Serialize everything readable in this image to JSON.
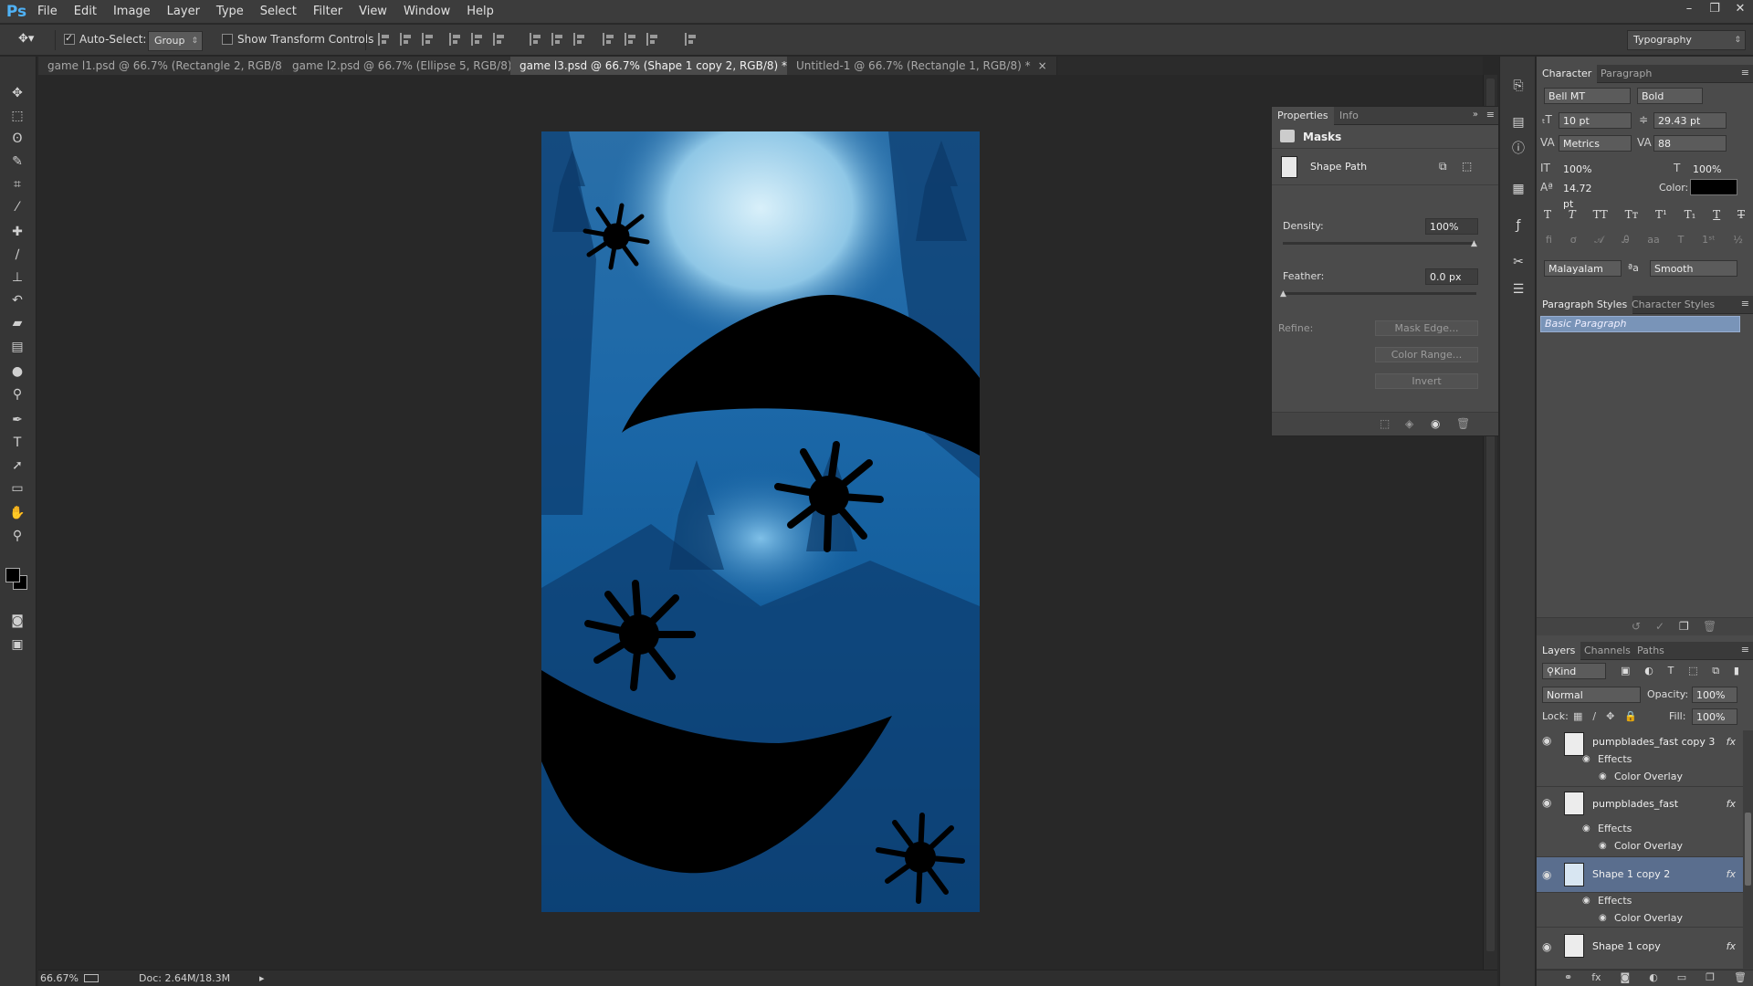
{
  "app": {
    "logo": "Ps"
  },
  "menu": [
    "File",
    "Edit",
    "Image",
    "Layer",
    "Type",
    "Select",
    "Filter",
    "View",
    "Window",
    "Help"
  ],
  "window_controls": [
    "–",
    "❐",
    "✕"
  ],
  "options_bar": {
    "auto_select_label": "Auto-Select:",
    "auto_select_value": "Group",
    "show_transform_label": "Show Transform Controls",
    "workspace": "Typography"
  },
  "tabs": [
    {
      "label": "game l1.psd @ 66.7% (Rectangle 2, RGB/8)",
      "active": false
    },
    {
      "label": "game l2.psd @ 66.7% (Ellipse 5, RGB/8)",
      "active": false
    },
    {
      "label": "game l3.psd @ 66.7% (Shape 1 copy 2, RGB/8) *",
      "active": true
    },
    {
      "label": "Untitled-1 @ 66.7% (Rectangle 1, RGB/8) *",
      "active": false
    }
  ],
  "tab_close": "×",
  "status": {
    "zoom": "66.67%",
    "doc": "Doc: 2.64M/18.3M"
  },
  "properties": {
    "tabs": [
      "Properties",
      "Info"
    ],
    "section": "Masks",
    "mask_type": "Shape Path",
    "density_label": "Density:",
    "density_value": "100%",
    "feather_label": "Feather:",
    "feather_value": "0.0 px",
    "refine_label": "Refine:",
    "buttons": [
      "Mask Edge...",
      "Color Range...",
      "Invert"
    ]
  },
  "character": {
    "tabs": [
      "Character",
      "Paragraph"
    ],
    "font_family": "Bell MT",
    "font_style": "Bold",
    "size": "10 pt",
    "leading": "29.43 pt",
    "kerning": "Metrics",
    "tracking": "88",
    "vscale": "100%",
    "hscale": "100%",
    "baseline": "14.72 pt",
    "color_label": "Color:",
    "language": "Malayalam",
    "aa_label": "a",
    "antialias": "Smooth"
  },
  "paragraph_styles": {
    "tabs": [
      "Paragraph Styles",
      "Character Styles"
    ],
    "items": [
      "Basic Paragraph"
    ]
  },
  "layers": {
    "tabs": [
      "Layers",
      "Channels",
      "Paths"
    ],
    "kind_label": "Kind",
    "blend_mode": "Normal",
    "opacity_label": "Opacity:",
    "opacity": "100%",
    "lock_label": "Lock:",
    "fill_label": "Fill:",
    "fill": "100%",
    "effects_label": "Effects",
    "color_overlay_label": "Color Overlay",
    "fx_label": "fx",
    "rows": [
      {
        "name": "pumpblades_fast copy 3",
        "selected": false
      },
      {
        "name": "pumpblades_fast",
        "selected": false
      },
      {
        "name": "Shape 1 copy 2",
        "selected": true
      },
      {
        "name": "Shape 1 copy",
        "selected": false
      }
    ]
  },
  "colors": {
    "accent": "#4fb2f6",
    "selection": "#5a6e8e",
    "canvas_bg": "#282828",
    "panel_bg": "#4b4b4b"
  }
}
